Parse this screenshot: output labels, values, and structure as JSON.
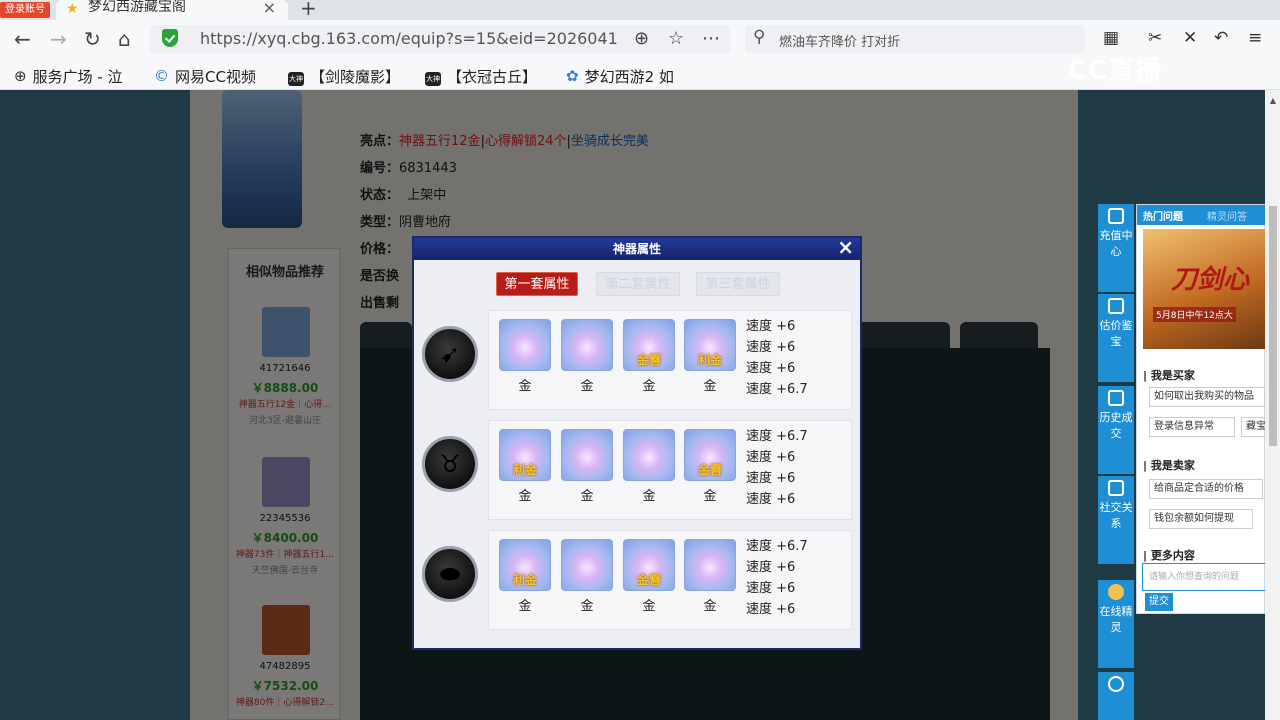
{
  "browser": {
    "login_badge": "登录账号",
    "tab_title": "梦幻西游藏宝阁",
    "tab_close": "×",
    "new_tab": "+",
    "url": "https://xyq.cbg.163.com/equip?s=15&eid=2026041",
    "search_text": "燃油车齐降价 打对折",
    "bookmarks": [
      "服务广场 - 泣",
      "网易CC视频",
      "【剑陵魔影】",
      "【衣冠古丘】",
      "梦幻西游2 如"
    ],
    "watermark": "CC直播"
  },
  "page": {
    "info": {
      "highlights_label": "亮点：",
      "highlights": [
        "神器五行12金",
        "心得解锁24个",
        "坐骑成长完美"
      ],
      "sep": "|",
      "number_label": "编号：",
      "number": "6831443",
      "status_label": "状态：",
      "status": "上架中",
      "type_label": "类型：",
      "type": "阴曹地府",
      "price_label": "价格：",
      "swap_label": "是否换",
      "sale_label": "出售剩"
    },
    "similar": {
      "title": "相似物品推荐",
      "items": [
        {
          "id": "41721646",
          "price": "￥8888.00",
          "desc": "神器五行12金｜心得…",
          "server": "河北3区-避暑山庄",
          "color": "#7aa6d8"
        },
        {
          "id": "22345536",
          "price": "￥8400.00",
          "desc": "神器73件｜神器五行1…",
          "server": "天竺佛国-云台寺",
          "color": "#9a8fc8"
        },
        {
          "id": "47482895",
          "price": "￥7532.00",
          "desc": "神器80件｜心得解锁2…",
          "server": "",
          "color": "#b2562a"
        }
      ]
    }
  },
  "sidebar": {
    "buttons": [
      "充值中心",
      "估价鉴宝",
      "历史成交",
      "社交关系",
      "在线精灵"
    ],
    "tabs": [
      "热门问题",
      "精灵问答"
    ],
    "banner_title": "刀剑心",
    "banner_date": "5月8日中午12点大",
    "buyer_heading": "我是买家",
    "buyer_questions": [
      "如何取出我购买的物品",
      "登录信息异常",
      "藏宝"
    ],
    "seller_heading": "我是卖家",
    "seller_questions": [
      "给商品定合适的价格",
      "钱包余额如何提现"
    ],
    "more_heading": "更多内容",
    "input_placeholder": "请输入你想查询的问题",
    "submit": "提交"
  },
  "modal": {
    "title": "神器属性",
    "close": "×",
    "tabs": [
      "第一套属性",
      "第二套属性",
      "第三套属性"
    ],
    "rows": [
      {
        "slot_icon": "weapon-slot-icon",
        "gems": [
          {
            "name": "金",
            "label": ""
          },
          {
            "name": "金",
            "label": ""
          },
          {
            "name": "金",
            "label": "金簪"
          },
          {
            "name": "金",
            "label": "利金"
          }
        ],
        "stats": [
          "速度 +6",
          "速度 +6",
          "速度 +6",
          "速度 +6.7"
        ]
      },
      {
        "slot_icon": "armor-slot-icon",
        "gems": [
          {
            "name": "金",
            "label": "利金"
          },
          {
            "name": "金",
            "label": ""
          },
          {
            "name": "金",
            "label": ""
          },
          {
            "name": "金",
            "label": "金簪"
          }
        ],
        "stats": [
          "速度 +6.7",
          "速度 +6",
          "速度 +6",
          "速度 +6"
        ]
      },
      {
        "slot_icon": "accessory-slot-icon",
        "gems": [
          {
            "name": "金",
            "label": "利金"
          },
          {
            "name": "金",
            "label": ""
          },
          {
            "name": "金",
            "label": "金簪"
          },
          {
            "name": "金",
            "label": ""
          }
        ],
        "stats": [
          "速度 +6.7",
          "速度 +6",
          "速度 +6",
          "速度 +6"
        ]
      }
    ]
  },
  "colors": {
    "accent": "#1e8fd5",
    "active_tab": "#b61d18",
    "gold_text": "#f4c52c",
    "modal_header": "#1a2a6e"
  }
}
